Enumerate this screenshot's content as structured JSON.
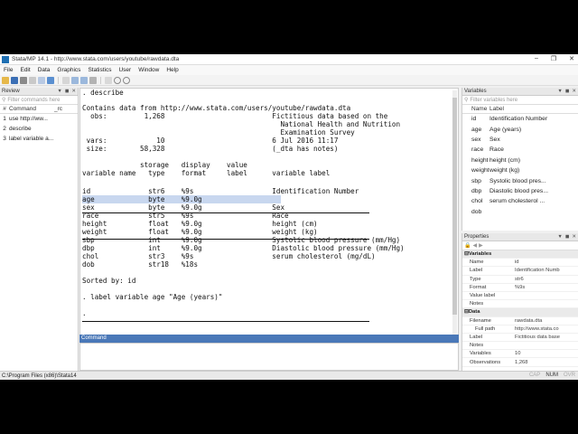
{
  "window": {
    "title": "Stata/MP 14.1 - http://www.stata.com/users/youtube/rawdata.dta",
    "controls": [
      "–",
      "❐",
      "✕"
    ]
  },
  "menu": [
    "File",
    "Edit",
    "Data",
    "Graphics",
    "Statistics",
    "User",
    "Window",
    "Help"
  ],
  "review": {
    "title": "Review",
    "filter_placeholder": "Filter commands here",
    "col_num": "#",
    "col_command": "Command",
    "col_rc": "_rc",
    "rows": [
      {
        "num": "1",
        "cmd": "use http://ww..."
      },
      {
        "num": "2",
        "cmd": "describe"
      },
      {
        "num": "3",
        "cmd": "label variable a..."
      }
    ]
  },
  "results": {
    "lines": [
      ". describe",
      "",
      "Contains data from http://www.stata.com/users/youtube/rawdata.dta",
      "  obs:         1,268                          Fictitious data based on the",
      "                                                National Health and Nutrition",
      "                                                Examination Survey",
      " vars:            10                          6 Jul 2016 11:17",
      " size:        58,328                          (_dta has notes)",
      "",
      "              storage   display    value",
      "variable name   type    format     label      variable label",
      "",
      "id              str6    %9s                   Identification Number",
      "age             byte    %9.0g",
      "sex             byte    %9.0g                 Sex",
      "race            str5    %9s                   Race",
      "height          float   %9.0g                 height (cm)",
      "weight          float   %9.0g                 weight (kg)",
      "sbp             int     %9.0g                 Systolic blood pressure (mm/Hg)",
      "dbp             int     %9.0g                 Diastolic blood pressure (mm/Hg)",
      "chol            str3    %9s                   serum cholesterol (mg/dL)",
      "dob             str18   %18s",
      "",
      "Sorted by: id",
      "",
      ". label variable age \"Age (years)\"",
      "",
      "."
    ]
  },
  "command": {
    "title": "Command"
  },
  "variables": {
    "title": "Variables",
    "filter_placeholder": "Filter variables here",
    "col_name": "Name",
    "col_label": "Label",
    "rows": [
      {
        "name": "id",
        "label": "Identification Number"
      },
      {
        "name": "age",
        "label": "Age (years)"
      },
      {
        "name": "sex",
        "label": "Sex"
      },
      {
        "name": "race",
        "label": "Race"
      },
      {
        "name": "height",
        "label": "height (cm)"
      },
      {
        "name": "weight",
        "label": "weight (kg)"
      },
      {
        "name": "sbp",
        "label": "Systolic blood pres..."
      },
      {
        "name": "dbp",
        "label": "Diastolic blood pres..."
      },
      {
        "name": "chol",
        "label": "serum cholesterol ..."
      },
      {
        "name": "dob",
        "label": ""
      }
    ]
  },
  "properties": {
    "title": "Properties",
    "rows": [
      {
        "key": "Variables",
        "val": "",
        "section": true
      },
      {
        "key": "Name",
        "val": "id"
      },
      {
        "key": "Label",
        "val": "Identification Numb"
      },
      {
        "key": "Type",
        "val": "str6"
      },
      {
        "key": "Format",
        "val": "%9s"
      },
      {
        "key": "Value label",
        "val": ""
      },
      {
        "key": "Notes",
        "val": ""
      },
      {
        "key": "Data",
        "val": "",
        "section": true
      },
      {
        "key": "Filename",
        "val": "rawdata.dta"
      },
      {
        "key": "Full path",
        "val": "http://www.stata.co"
      },
      {
        "key": "Label",
        "val": "Fictitious data base"
      },
      {
        "key": "Notes",
        "val": ""
      },
      {
        "key": "Variables",
        "val": "10"
      },
      {
        "key": "Observations",
        "val": "1,268"
      }
    ]
  },
  "status": {
    "path": "C:\\Program Files (x86)\\Stata14",
    "indicators": [
      "CAP",
      "NUM",
      "OVR"
    ]
  }
}
